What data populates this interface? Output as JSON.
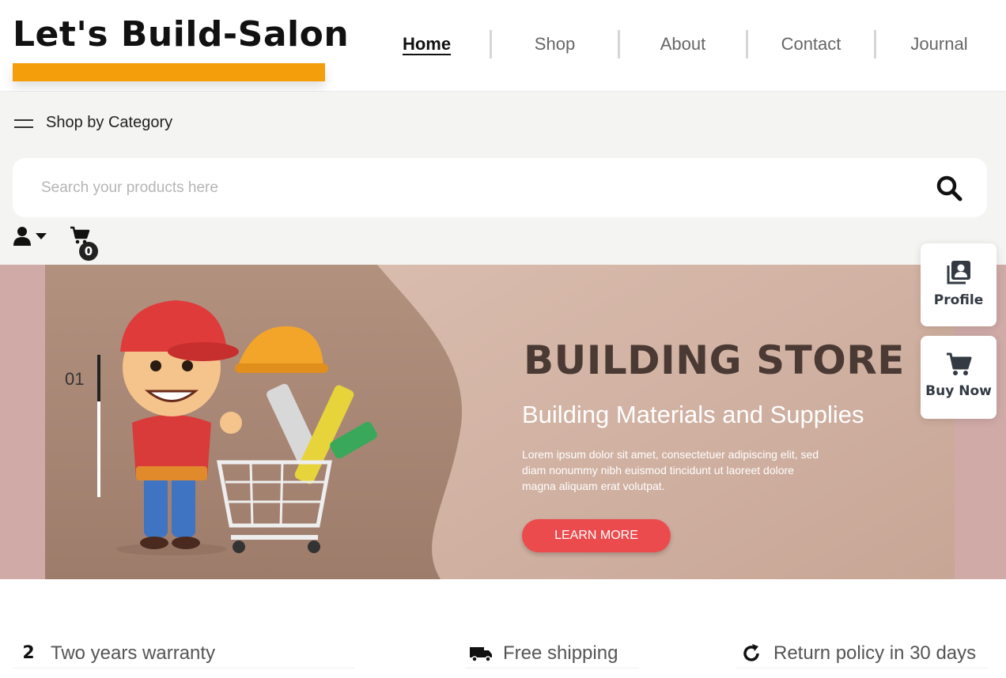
{
  "brand": {
    "logo_text": "Let's Build-Salon",
    "accent_color": "#f59e0b"
  },
  "nav": {
    "items": [
      {
        "label": "Home",
        "active": true
      },
      {
        "label": "Shop",
        "active": false
      },
      {
        "label": "About",
        "active": false
      },
      {
        "label": "Contact",
        "active": false
      },
      {
        "label": "Journal",
        "active": false
      }
    ]
  },
  "category": {
    "label": "Shop by Category",
    "icon": "menu-icon"
  },
  "search": {
    "placeholder": "Search your products here",
    "value": "",
    "icon": "search-icon"
  },
  "account": {
    "icon": "user-icon",
    "dropdown_icon": "caret-down-icon"
  },
  "cart": {
    "icon": "cart-icon",
    "count": "0"
  },
  "hero": {
    "slide_number": "01",
    "slide_progress": 0.33,
    "title": "BUILDING STORE",
    "subtitle": "Building Materials and Supplies",
    "body": "Lorem ipsum dolor sit amet, consectetuer adipiscing elit, sed diam nonummy nibh euismod tincidunt ut laoreet dolore magna aliquam erat volutpat.",
    "cta_label": "LEARN MORE",
    "cta_color": "#ec4b4e"
  },
  "side_buttons": [
    {
      "label": "Profile",
      "icon": "profile-card-icon"
    },
    {
      "label": "Buy Now",
      "icon": "cart-icon"
    }
  ],
  "features": [
    {
      "icon_text": "2",
      "label": "Two years warranty"
    },
    {
      "icon": "truck-icon",
      "label": "Free shipping"
    },
    {
      "icon": "refresh-icon",
      "label": "Return policy in 30 days"
    }
  ]
}
